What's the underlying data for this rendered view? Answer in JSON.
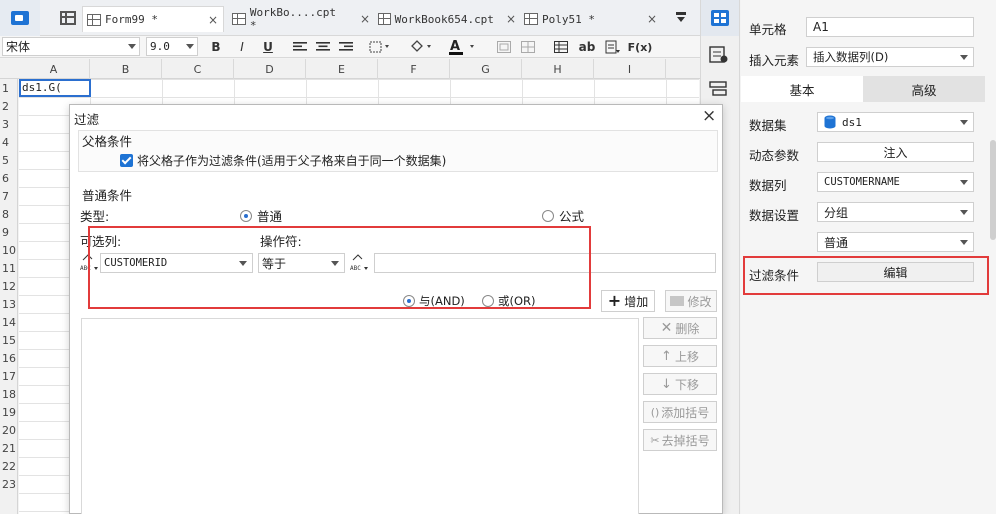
{
  "tabs": [
    {
      "label": "Form99 *"
    },
    {
      "label": "WorkBo....cpt *"
    },
    {
      "label": "WorkBook654.cpt"
    },
    {
      "label": "Poly51 *"
    }
  ],
  "tab_close": "×",
  "toolbar": {
    "font_name": "宋体",
    "font_size": "9.0",
    "bold": "B",
    "italic": "I",
    "underline": "U",
    "abc": "ab",
    "fx": "F(x)"
  },
  "sheet": {
    "columns": [
      "A",
      "B",
      "C",
      "D",
      "E",
      "F",
      "G",
      "H",
      "I"
    ],
    "rows": [
      "1",
      "2",
      "3",
      "4",
      "5",
      "6",
      "7",
      "8",
      "9",
      "10",
      "11",
      "12",
      "13",
      "14",
      "15",
      "16",
      "17",
      "18",
      "19",
      "20",
      "21",
      "22",
      "23"
    ],
    "cell_a1": "ds1.G("
  },
  "right_panel": {
    "cell_label": "单元格",
    "cell_value": "A1",
    "insert_label": "插入元素",
    "insert_value": "插入数据列(D)",
    "tab_basic": "基本",
    "tab_advanced": "高级",
    "dataset_label": "数据集",
    "dataset_value": "ds1",
    "param_label": "动态参数",
    "param_button": "注入",
    "column_label": "数据列",
    "column_value": "CUSTOMERNAME",
    "setting_label": "数据设置",
    "setting_value": "分组",
    "setting_value2": "普通",
    "filter_label": "过滤条件",
    "filter_button": "编辑"
  },
  "dialog": {
    "title": "过滤",
    "close": "×",
    "parent_section": "父格条件",
    "parent_checkbox": "将父格子作为过滤条件(适用于父子格来自于同一个数据集)",
    "normal_section": "普通条件",
    "type_label": "类型:",
    "type_normal": "普通",
    "type_formula": "公式",
    "col_label_prefix": "可",
    "col_label": "选列:",
    "column_value": "CUSTOMERID",
    "operator_label": "操作符:",
    "operator_value": "等于",
    "value_input": "",
    "and_label": "与(AND)",
    "or_label": "或(OR)",
    "add_button": "增加",
    "modify_button": "修改",
    "delete_button": "删除",
    "up_button": "上移",
    "down_button": "下移",
    "add_paren_button": "添加括号",
    "remove_paren_button": "去掉括号"
  },
  "colors": {
    "accent": "#1e73d4",
    "highlight_box": "#e23b3b"
  }
}
